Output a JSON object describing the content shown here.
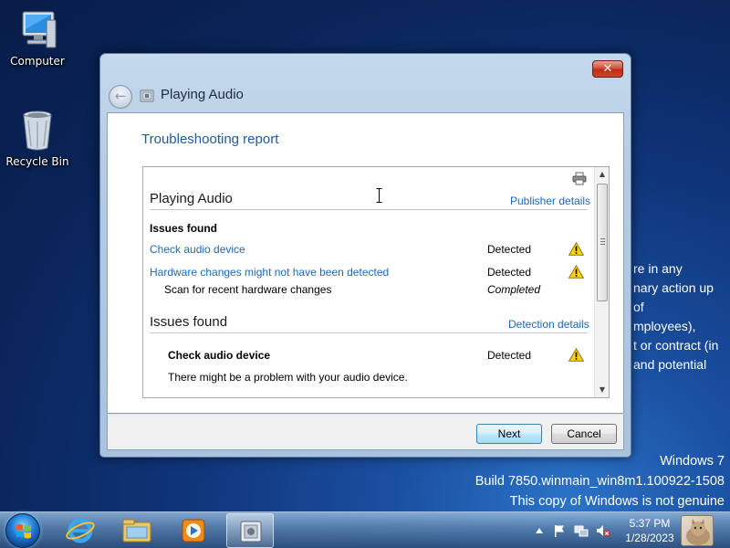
{
  "desktop": {
    "icons": [
      {
        "label": "Computer",
        "icon": "computer-icon"
      },
      {
        "label": "Recycle Bin",
        "icon": "recycle-bin-icon"
      }
    ],
    "background_text": [
      "re in any",
      "nary action up",
      "of",
      "mployees),",
      "t or contract (in",
      "and potential"
    ],
    "watermark": {
      "line1": "Windows 7",
      "line2": "Build 7850.winmain_win8m1.100922-1508",
      "line3": "This copy of Windows is not genuine"
    }
  },
  "window": {
    "title": "Playing Audio",
    "close_label": "✕",
    "heading": "Troubleshooting report",
    "report": {
      "section1_title": "Playing Audio",
      "publisher_link": "Publisher details",
      "issues_label": "Issues found",
      "issues": [
        {
          "name": "Check audio device",
          "status": "Detected",
          "icon": "warning-icon"
        },
        {
          "name": "Hardware changes might not have been detected",
          "status": "Detected",
          "icon": "warning-icon"
        }
      ],
      "sub_item": {
        "name": "Scan for recent hardware changes",
        "status": "Completed"
      },
      "section2_title": "Issues found",
      "detection_link": "Detection details",
      "detail": {
        "name": "Check audio device",
        "status": "Detected",
        "description": "There might be a problem with your audio device."
      }
    },
    "buttons": {
      "next": "Next",
      "cancel": "Cancel"
    }
  },
  "taskbar": {
    "pinned": [
      "start-orb",
      "internet-explorer-icon",
      "explorer-icon",
      "media-player-icon",
      "troubleshooter-icon"
    ],
    "tray": [
      "show-hidden-icon",
      "action-center-flag-icon",
      "network-icon",
      "volume-muted-icon"
    ],
    "clock": {
      "time": "5:37 PM",
      "date": "1/28/2023"
    }
  },
  "colors": {
    "link": "#1e68b6",
    "heading": "#1e5a9e",
    "warning": "#f5cf1c"
  }
}
